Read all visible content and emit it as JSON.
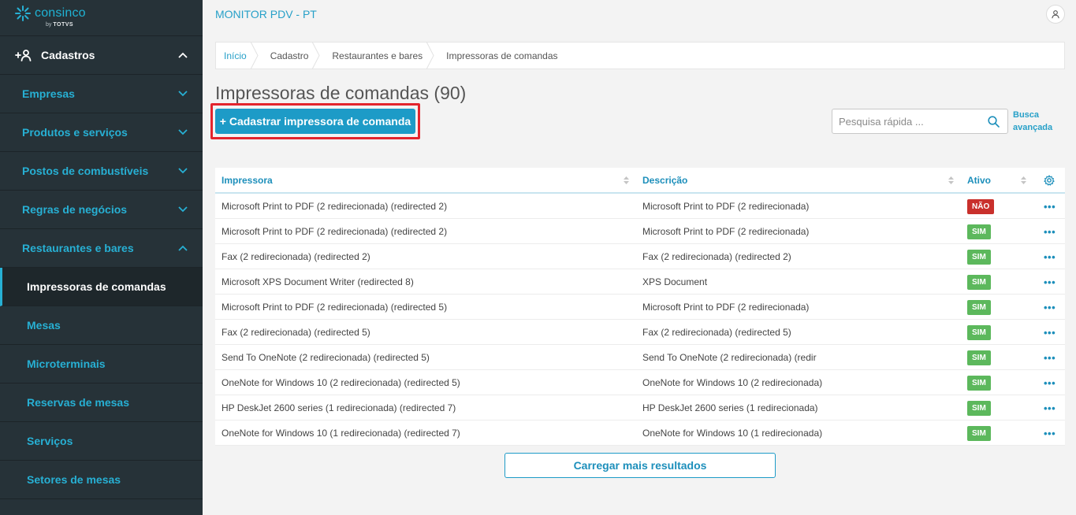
{
  "brand": {
    "name": "consinco",
    "by": "by",
    "partner": "TOTVS",
    "accent": "#27b0d4"
  },
  "sidebar": {
    "section": {
      "label": "Cadastros",
      "icon": "add-user-icon"
    },
    "items": [
      {
        "label": "Empresas",
        "expanded": false
      },
      {
        "label": "Produtos e serviços",
        "expanded": false
      },
      {
        "label": "Postos de combustíveis",
        "expanded": false
      },
      {
        "label": "Regras de negócios",
        "expanded": false
      },
      {
        "label": "Restaurantes e bares",
        "expanded": true
      }
    ],
    "subitems": [
      {
        "label": "Impressoras de comandas",
        "active": true
      },
      {
        "label": "Mesas"
      },
      {
        "label": "Microterminais"
      },
      {
        "label": "Reservas de mesas"
      },
      {
        "label": "Serviços"
      },
      {
        "label": "Setores de mesas"
      }
    ]
  },
  "header": {
    "app_title": "MONITOR PDV - PT"
  },
  "breadcrumb": [
    "Início",
    "Cadastro",
    "Restaurantes e bares",
    "Impressoras de comandas"
  ],
  "page": {
    "title": "Impressoras de comandas (90)",
    "add_button": "+ Cadastrar impressora de comanda",
    "search_placeholder": "Pesquisa rápida ...",
    "advanced_search": "Busca avançada",
    "load_more": "Carregar mais resultados"
  },
  "table": {
    "columns": [
      "Impressora",
      "Descrição",
      "Ativo"
    ],
    "rows": [
      {
        "printer": "Microsoft Print to PDF (2 redirecionada) (redirected 2)",
        "description": "Microsoft Print to PDF (2 redirecionada)",
        "active": "NÃO",
        "status": "no"
      },
      {
        "printer": "Microsoft Print to PDF (2 redirecionada) (redirected 2)",
        "description": "Microsoft Print to PDF (2 redirecionada)",
        "active": "SIM",
        "status": "yes"
      },
      {
        "printer": "Fax (2 redirecionada) (redirected 2)",
        "description": "Fax (2 redirecionada) (redirected 2)",
        "active": "SIM",
        "status": "yes"
      },
      {
        "printer": "Microsoft XPS Document Writer (redirected 8)",
        "description": "XPS Document",
        "active": "SIM",
        "status": "yes"
      },
      {
        "printer": "Microsoft Print to PDF (2 redirecionada) (redirected 5)",
        "description": "Microsoft Print to PDF (2 redirecionada)",
        "active": "SIM",
        "status": "yes"
      },
      {
        "printer": "Fax (2 redirecionada) (redirected 5)",
        "description": "Fax (2 redirecionada) (redirected 5)",
        "active": "SIM",
        "status": "yes"
      },
      {
        "printer": "Send To OneNote (2 redirecionada) (redirected 5)",
        "description": "Send To OneNote (2 redirecionada) (redir",
        "active": "SIM",
        "status": "yes"
      },
      {
        "printer": "OneNote for Windows 10 (2 redirecionada) (redirected 5)",
        "description": "OneNote for Windows 10 (2 redirecionada)",
        "active": "SIM",
        "status": "yes"
      },
      {
        "printer": "HP DeskJet 2600 series (1 redirecionada) (redirected 7)",
        "description": "HP DeskJet 2600 series (1 redirecionada)",
        "active": "SIM",
        "status": "yes"
      },
      {
        "printer": "OneNote for Windows 10 (1 redirecionada) (redirected 7)",
        "description": "OneNote for Windows 10 (1 redirecionada)",
        "active": "SIM",
        "status": "yes"
      }
    ],
    "row_action": "•••"
  }
}
